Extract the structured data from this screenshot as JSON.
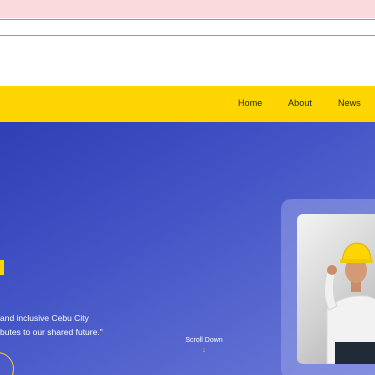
{
  "nav": {
    "items": [
      {
        "label": "Home"
      },
      {
        "label": "About"
      },
      {
        "label": "News"
      }
    ]
  },
  "hero": {
    "line1": "and inclusive Cebu City",
    "line2": "butes to our shared future.\"",
    "scroll_label": "Scroll Down",
    "scroll_icon": "arrow-down-icon"
  },
  "colors": {
    "accent": "#ffd500",
    "hero_bg": "#4254c6",
    "top_band": "#fadadd"
  }
}
